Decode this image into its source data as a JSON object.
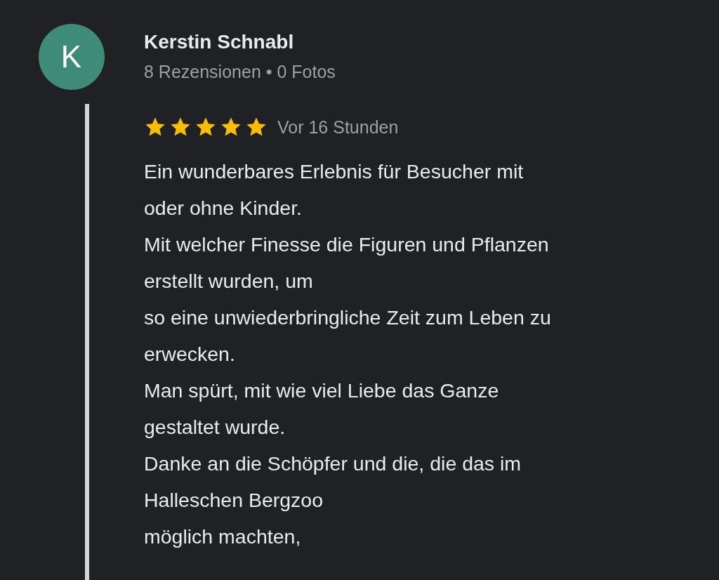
{
  "review": {
    "avatar": {
      "letter": "K",
      "color": "#3e8b79"
    },
    "author": "Kerstin Schnabl",
    "meta": "8 Rezensionen • 0 Fotos",
    "stars": 5,
    "time": "Vor 16 Stunden",
    "text": "Ein wunderbares Erlebnis für Besucher mit\noder ohne Kinder.\nMit welcher Finesse die Figuren und Pflanzen\nerstellt wurden, um\nso eine unwiederbringliche Zeit zum Leben zu\nerwecken.\nMan spürt, mit wie viel Liebe das Ganze\ngestaltet wurde.\nDanke an die Schöpfer und die, die das im\nHalleschen Bergzoo\nmöglich machten,"
  }
}
